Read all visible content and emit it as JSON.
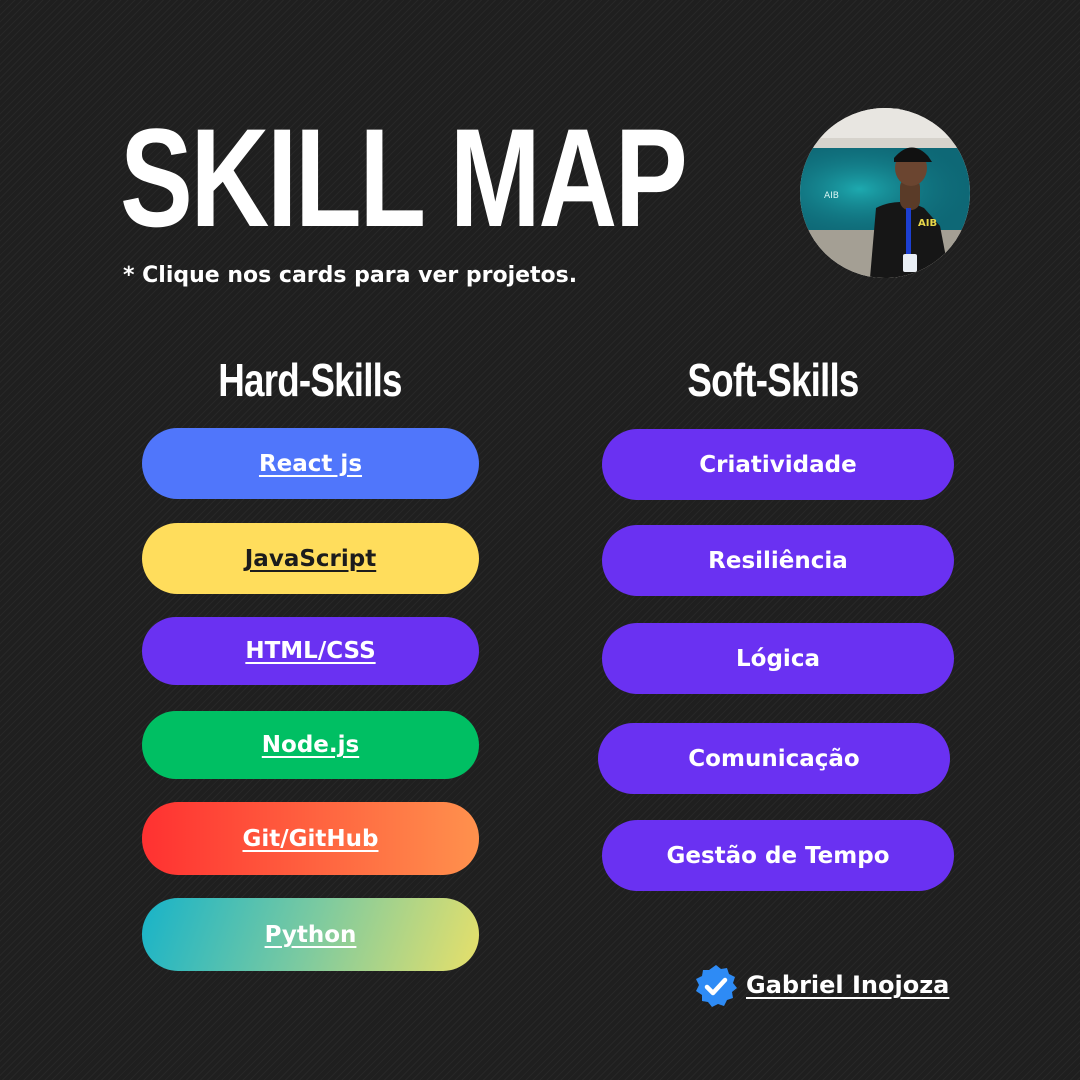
{
  "header": {
    "title": "SKILL MAP",
    "subtitle": "* Clique nos cards para ver projetos."
  },
  "hard_skills": {
    "heading": "Hard-Skills",
    "items": [
      {
        "label": "React js",
        "color": "#5076fb"
      },
      {
        "label": "JavaScript",
        "color": "#ffdd5c"
      },
      {
        "label": "HTML/CSS",
        "color": "#6a31f2"
      },
      {
        "label": "Node.js",
        "color": "#00bf63"
      },
      {
        "label": "Git/GitHub",
        "color": "#ff3b36"
      },
      {
        "label": "Python",
        "color": "#1fb5c8"
      }
    ]
  },
  "soft_skills": {
    "heading": "Soft-Skills",
    "items": [
      {
        "label": "Criatividade",
        "color": "#6a31f2"
      },
      {
        "label": "Resiliência",
        "color": "#6a31f2"
      },
      {
        "label": "Lógica",
        "color": "#6a31f2"
      },
      {
        "label": "Comunicação",
        "color": "#6a31f2"
      },
      {
        "label": "Gestão de Tempo",
        "color": "#6a31f2"
      }
    ]
  },
  "footer": {
    "author": "Gabriel Inojoza",
    "badge_icon": "verified-check-icon",
    "badge_color": "#2e8bf5"
  },
  "avatar": {
    "icon": "profile-photo",
    "screen_text": "AIB"
  }
}
